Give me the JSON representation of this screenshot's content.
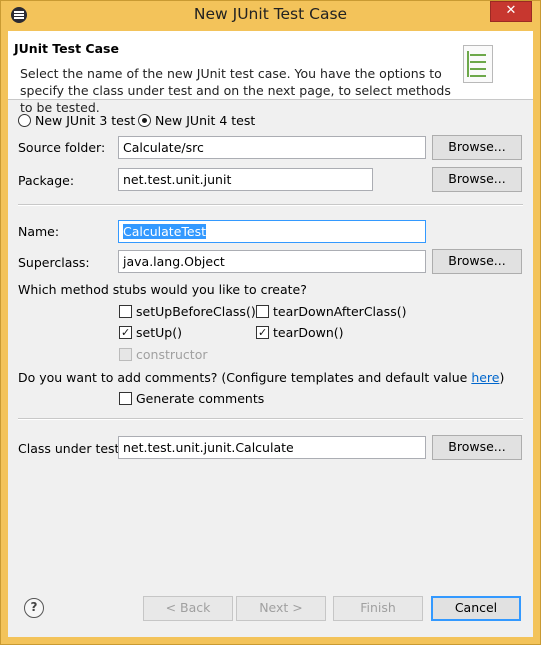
{
  "window": {
    "title": "New JUnit Test Case",
    "close_glyph": "✕"
  },
  "banner": {
    "title": "JUnit Test Case",
    "description": "Select the name of the new JUnit test case. You have the options to specify the class under test and on the next page, to select methods to be tested."
  },
  "junit_version": {
    "junit3_label": "New JUnit 3 test",
    "junit4_label": "New JUnit 4 test",
    "selected": "junit4"
  },
  "source_folder": {
    "label": "Source folder:",
    "value": "Calculate/src",
    "browse_label": "Browse..."
  },
  "package": {
    "label": "Package:",
    "value": "net.test.unit.junit",
    "browse_label": "Browse..."
  },
  "name": {
    "label": "Name:",
    "value": "CalculateTest"
  },
  "superclass": {
    "label": "Superclass:",
    "value": "java.lang.Object",
    "browse_label": "Browse..."
  },
  "stubs": {
    "question": "Which method stubs would you like to create?",
    "setUpBeforeClass": "setUpBeforeClass()",
    "tearDownAfterClass": "tearDownAfterClass()",
    "setUp": "setUp()",
    "tearDown": "tearDown()",
    "constructor": "constructor"
  },
  "comments": {
    "question_prefix": "Do you want to add comments? (Configure templates and default value ",
    "link": "here",
    "question_suffix": ")",
    "generate_label": "Generate comments"
  },
  "class_under_test": {
    "label": "Class under test:",
    "value": "net.test.unit.junit.Calculate",
    "browse_label": "Browse..."
  },
  "footer": {
    "help_glyph": "?",
    "back_label": "< Back",
    "next_label": "Next >",
    "finish_label": "Finish",
    "cancel_label": "Cancel"
  },
  "colors": {
    "frame": "#f3c35a",
    "close": "#c7372f",
    "selection": "#3399ff",
    "link": "#0066cc"
  }
}
